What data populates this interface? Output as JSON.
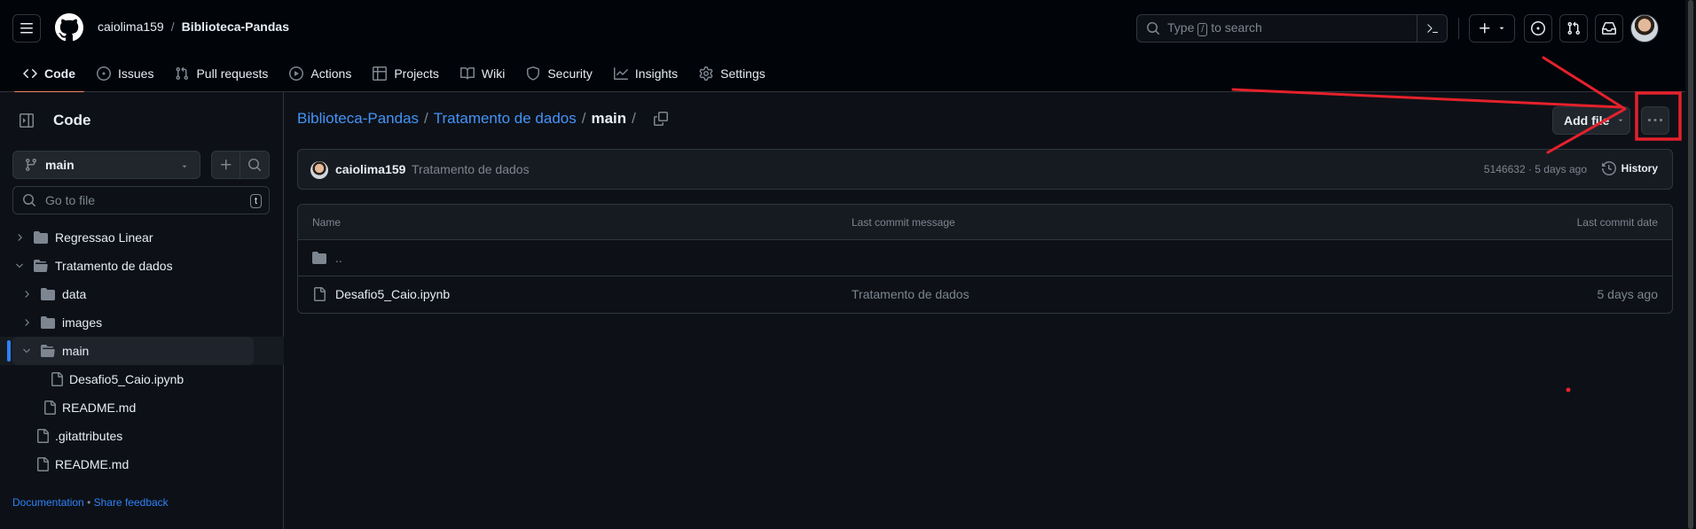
{
  "header": {
    "owner": "caiolima159",
    "separator": "/",
    "repo": "Biblioteca-Pandas",
    "search_placeholder_pre": "Type",
    "search_key": "/",
    "search_placeholder_post": "to search",
    "avatar_icon": "user-avatar"
  },
  "tabs": [
    {
      "label": "Code",
      "icon": "code-icon",
      "active": true
    },
    {
      "label": "Issues",
      "icon": "issue-icon"
    },
    {
      "label": "Pull requests",
      "icon": "pull-request-icon"
    },
    {
      "label": "Actions",
      "icon": "play-icon"
    },
    {
      "label": "Projects",
      "icon": "table-icon"
    },
    {
      "label": "Wiki",
      "icon": "book-icon"
    },
    {
      "label": "Security",
      "icon": "shield-icon"
    },
    {
      "label": "Insights",
      "icon": "graph-icon"
    },
    {
      "label": "Settings",
      "icon": "gear-icon"
    }
  ],
  "sidebar": {
    "title": "Code",
    "branch": "main",
    "goto_placeholder": "Go to file",
    "goto_key": "t",
    "tree": [
      {
        "label": "Regressao Linear",
        "type": "folder",
        "level": 0,
        "expanded": false
      },
      {
        "label": "Tratamento de dados",
        "type": "folder",
        "level": 0,
        "expanded": true
      },
      {
        "label": "data",
        "type": "folder",
        "level": 1,
        "expanded": false
      },
      {
        "label": "images",
        "type": "folder",
        "level": 1,
        "expanded": false
      },
      {
        "label": "main",
        "type": "folder",
        "level": 1,
        "expanded": true,
        "selected": true
      },
      {
        "label": "Desafio5_Caio.ipynb",
        "type": "file",
        "level": 2
      },
      {
        "label": "README.md",
        "type": "file",
        "level": 1
      },
      {
        "label": ".gitattributes",
        "type": "file",
        "level": 0
      },
      {
        "label": "README.md",
        "type": "file",
        "level": 0
      }
    ],
    "footer_docs": "Documentation",
    "footer_sep": "•",
    "footer_feedback": "Share feedback"
  },
  "main": {
    "path": {
      "repo": "Biblioteca-Pandas",
      "sep1": "/",
      "folder": "Tratamento de dados",
      "sep2": "/",
      "current": "main",
      "sep3": "/"
    },
    "add_file_label": "Add file",
    "commit": {
      "author": "caiolima159",
      "message": "Tratamento de dados",
      "meta": "5146632 · 5 days ago",
      "history_label": "History"
    },
    "table": {
      "headers": [
        "Name",
        "Last commit message",
        "Last commit date"
      ],
      "rows": [
        {
          "name": "..",
          "icon": "folder-icon",
          "message": "",
          "date": ""
        },
        {
          "name": "Desafio5_Caio.ipynb",
          "icon": "file-icon",
          "message": "Tratamento de dados",
          "date": "5 days ago"
        }
      ]
    }
  },
  "colors": {
    "bg": "#0d1117",
    "header_bg": "#010409",
    "border": "#30363d",
    "link": "#4493f8",
    "muted": "#7d8590",
    "tab_underline": "#f78166",
    "annotation_red": "#e5212b"
  }
}
